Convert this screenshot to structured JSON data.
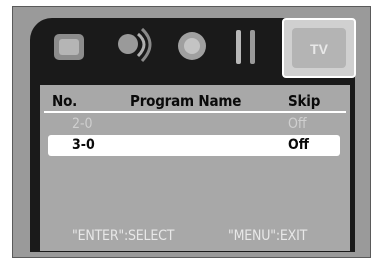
{
  "menu_icons": [
    "picture-icon",
    "sound-icon",
    "setup-icon",
    "tools-icon",
    "tv-icon"
  ],
  "tv_icon_label": "TV",
  "header": {
    "col_no": "No.",
    "col_name": "Program Name",
    "col_skip": "Skip"
  },
  "rows": [
    {
      "no": "2-0",
      "skip": "Off",
      "selected": false
    },
    {
      "no": "3-0",
      "skip": "Off",
      "selected": true
    }
  ],
  "footer": {
    "select_hint": "\"ENTER\":SELECT",
    "exit_hint": "\"MENU\":EXIT"
  }
}
